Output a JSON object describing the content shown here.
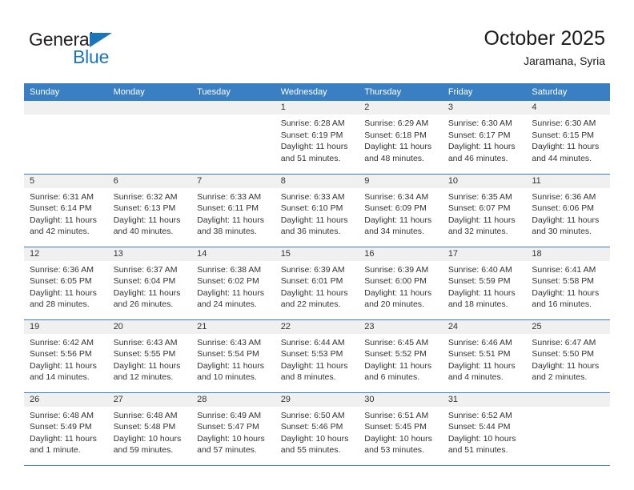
{
  "brand": {
    "line1": "General",
    "line2": "Blue",
    "triangle_color": "#1b75bb"
  },
  "header": {
    "title": "October 2025",
    "subtitle": "Jaramana, Syria"
  },
  "theme": {
    "header_row_bg": "#3a7fc1",
    "daynum_band_bg": "#f0f0f0",
    "row_divider": "#3a7fc1",
    "text": "#333333"
  },
  "weekdays": [
    "Sunday",
    "Monday",
    "Tuesday",
    "Wednesday",
    "Thursday",
    "Friday",
    "Saturday"
  ],
  "calendar": {
    "weeks": [
      [
        {
          "day": "",
          "empty": true
        },
        {
          "day": "",
          "empty": true
        },
        {
          "day": "",
          "empty": true
        },
        {
          "day": "1",
          "sunrise": "Sunrise: 6:28 AM",
          "sunset": "Sunset: 6:19 PM",
          "daylight_l1": "Daylight: 11 hours",
          "daylight_l2": "and 51 minutes."
        },
        {
          "day": "2",
          "sunrise": "Sunrise: 6:29 AM",
          "sunset": "Sunset: 6:18 PM",
          "daylight_l1": "Daylight: 11 hours",
          "daylight_l2": "and 48 minutes."
        },
        {
          "day": "3",
          "sunrise": "Sunrise: 6:30 AM",
          "sunset": "Sunset: 6:17 PM",
          "daylight_l1": "Daylight: 11 hours",
          "daylight_l2": "and 46 minutes."
        },
        {
          "day": "4",
          "sunrise": "Sunrise: 6:30 AM",
          "sunset": "Sunset: 6:15 PM",
          "daylight_l1": "Daylight: 11 hours",
          "daylight_l2": "and 44 minutes."
        }
      ],
      [
        {
          "day": "5",
          "sunrise": "Sunrise: 6:31 AM",
          "sunset": "Sunset: 6:14 PM",
          "daylight_l1": "Daylight: 11 hours",
          "daylight_l2": "and 42 minutes."
        },
        {
          "day": "6",
          "sunrise": "Sunrise: 6:32 AM",
          "sunset": "Sunset: 6:13 PM",
          "daylight_l1": "Daylight: 11 hours",
          "daylight_l2": "and 40 minutes."
        },
        {
          "day": "7",
          "sunrise": "Sunrise: 6:33 AM",
          "sunset": "Sunset: 6:11 PM",
          "daylight_l1": "Daylight: 11 hours",
          "daylight_l2": "and 38 minutes."
        },
        {
          "day": "8",
          "sunrise": "Sunrise: 6:33 AM",
          "sunset": "Sunset: 6:10 PM",
          "daylight_l1": "Daylight: 11 hours",
          "daylight_l2": "and 36 minutes."
        },
        {
          "day": "9",
          "sunrise": "Sunrise: 6:34 AM",
          "sunset": "Sunset: 6:09 PM",
          "daylight_l1": "Daylight: 11 hours",
          "daylight_l2": "and 34 minutes."
        },
        {
          "day": "10",
          "sunrise": "Sunrise: 6:35 AM",
          "sunset": "Sunset: 6:07 PM",
          "daylight_l1": "Daylight: 11 hours",
          "daylight_l2": "and 32 minutes."
        },
        {
          "day": "11",
          "sunrise": "Sunrise: 6:36 AM",
          "sunset": "Sunset: 6:06 PM",
          "daylight_l1": "Daylight: 11 hours",
          "daylight_l2": "and 30 minutes."
        }
      ],
      [
        {
          "day": "12",
          "sunrise": "Sunrise: 6:36 AM",
          "sunset": "Sunset: 6:05 PM",
          "daylight_l1": "Daylight: 11 hours",
          "daylight_l2": "and 28 minutes."
        },
        {
          "day": "13",
          "sunrise": "Sunrise: 6:37 AM",
          "sunset": "Sunset: 6:04 PM",
          "daylight_l1": "Daylight: 11 hours",
          "daylight_l2": "and 26 minutes."
        },
        {
          "day": "14",
          "sunrise": "Sunrise: 6:38 AM",
          "sunset": "Sunset: 6:02 PM",
          "daylight_l1": "Daylight: 11 hours",
          "daylight_l2": "and 24 minutes."
        },
        {
          "day": "15",
          "sunrise": "Sunrise: 6:39 AM",
          "sunset": "Sunset: 6:01 PM",
          "daylight_l1": "Daylight: 11 hours",
          "daylight_l2": "and 22 minutes."
        },
        {
          "day": "16",
          "sunrise": "Sunrise: 6:39 AM",
          "sunset": "Sunset: 6:00 PM",
          "daylight_l1": "Daylight: 11 hours",
          "daylight_l2": "and 20 minutes."
        },
        {
          "day": "17",
          "sunrise": "Sunrise: 6:40 AM",
          "sunset": "Sunset: 5:59 PM",
          "daylight_l1": "Daylight: 11 hours",
          "daylight_l2": "and 18 minutes."
        },
        {
          "day": "18",
          "sunrise": "Sunrise: 6:41 AM",
          "sunset": "Sunset: 5:58 PM",
          "daylight_l1": "Daylight: 11 hours",
          "daylight_l2": "and 16 minutes."
        }
      ],
      [
        {
          "day": "19",
          "sunrise": "Sunrise: 6:42 AM",
          "sunset": "Sunset: 5:56 PM",
          "daylight_l1": "Daylight: 11 hours",
          "daylight_l2": "and 14 minutes."
        },
        {
          "day": "20",
          "sunrise": "Sunrise: 6:43 AM",
          "sunset": "Sunset: 5:55 PM",
          "daylight_l1": "Daylight: 11 hours",
          "daylight_l2": "and 12 minutes."
        },
        {
          "day": "21",
          "sunrise": "Sunrise: 6:43 AM",
          "sunset": "Sunset: 5:54 PM",
          "daylight_l1": "Daylight: 11 hours",
          "daylight_l2": "and 10 minutes."
        },
        {
          "day": "22",
          "sunrise": "Sunrise: 6:44 AM",
          "sunset": "Sunset: 5:53 PM",
          "daylight_l1": "Daylight: 11 hours",
          "daylight_l2": "and 8 minutes."
        },
        {
          "day": "23",
          "sunrise": "Sunrise: 6:45 AM",
          "sunset": "Sunset: 5:52 PM",
          "daylight_l1": "Daylight: 11 hours",
          "daylight_l2": "and 6 minutes."
        },
        {
          "day": "24",
          "sunrise": "Sunrise: 6:46 AM",
          "sunset": "Sunset: 5:51 PM",
          "daylight_l1": "Daylight: 11 hours",
          "daylight_l2": "and 4 minutes."
        },
        {
          "day": "25",
          "sunrise": "Sunrise: 6:47 AM",
          "sunset": "Sunset: 5:50 PM",
          "daylight_l1": "Daylight: 11 hours",
          "daylight_l2": "and 2 minutes."
        }
      ],
      [
        {
          "day": "26",
          "sunrise": "Sunrise: 6:48 AM",
          "sunset": "Sunset: 5:49 PM",
          "daylight_l1": "Daylight: 11 hours",
          "daylight_l2": "and 1 minute."
        },
        {
          "day": "27",
          "sunrise": "Sunrise: 6:48 AM",
          "sunset": "Sunset: 5:48 PM",
          "daylight_l1": "Daylight: 10 hours",
          "daylight_l2": "and 59 minutes."
        },
        {
          "day": "28",
          "sunrise": "Sunrise: 6:49 AM",
          "sunset": "Sunset: 5:47 PM",
          "daylight_l1": "Daylight: 10 hours",
          "daylight_l2": "and 57 minutes."
        },
        {
          "day": "29",
          "sunrise": "Sunrise: 6:50 AM",
          "sunset": "Sunset: 5:46 PM",
          "daylight_l1": "Daylight: 10 hours",
          "daylight_l2": "and 55 minutes."
        },
        {
          "day": "30",
          "sunrise": "Sunrise: 6:51 AM",
          "sunset": "Sunset: 5:45 PM",
          "daylight_l1": "Daylight: 10 hours",
          "daylight_l2": "and 53 minutes."
        },
        {
          "day": "31",
          "sunrise": "Sunrise: 6:52 AM",
          "sunset": "Sunset: 5:44 PM",
          "daylight_l1": "Daylight: 10 hours",
          "daylight_l2": "and 51 minutes."
        },
        {
          "day": "",
          "empty": true
        }
      ]
    ]
  }
}
